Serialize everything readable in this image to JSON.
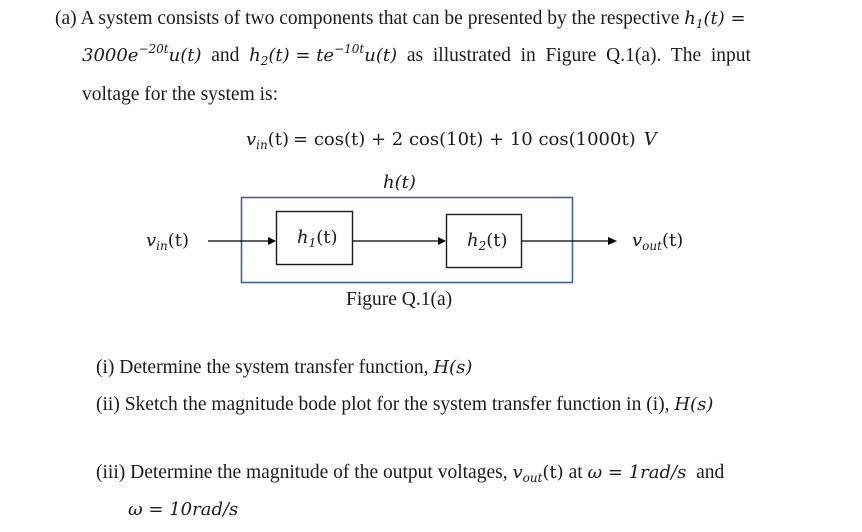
{
  "part_a": {
    "label": "(a)",
    "line1_text": "A system consists of two components that can be presented by the respective",
    "h1_lhs": "h",
    "h1_sub": "1",
    "h1_arg": "(t) =",
    "line2_h1_coef": "3000e",
    "line2_h1_exp": "−20t",
    "line2_h1_tail": "u(t)",
    "line2_and": "and",
    "h2_lhs": "h",
    "h2_sub": "2",
    "h2_arg": "(t) = te",
    "h2_exp": "−10t",
    "h2_tail": "u(t)",
    "line2_rest": "as  illustrated  in  Figure  Q.1(a).  The  input",
    "line3": "voltage for the system is:"
  },
  "equation": {
    "lhs_v": "v",
    "lhs_sub": "in",
    "lhs_arg": "(t)",
    "rhs": "= cos(t) + 2 cos(10t) + 10 cos(1000t)",
    "unit": "V"
  },
  "diagram": {
    "system_label": "h(t)",
    "input_label_v": "v",
    "input_label_sub": "in",
    "input_label_arg": "(t)",
    "block1_h": "h",
    "block1_sub": "1",
    "block1_arg": "(t)",
    "block2_h": "h",
    "block2_sub": "2",
    "block2_arg": "(t)",
    "output_label_v": "v",
    "output_label_sub": "out",
    "output_label_arg": "(t)",
    "caption": "Figure Q.1(a)",
    "colors": {
      "outer_box": "#41629a",
      "inner_box": "#1a1a1a",
      "arrow": "#000000"
    }
  },
  "questions": [
    {
      "label": "(i)",
      "text": "Determine the system transfer function,",
      "math": "H(s)"
    },
    {
      "label": "(ii)",
      "text": "Sketch the magnitude bode plot for the system transfer function in (i),",
      "math": "H(s)"
    },
    {
      "label": "(iii)",
      "text": "Determine the magnitude of the output voltages,",
      "v": "v",
      "v_sub": "out",
      "v_arg": "(t)",
      "at": "at",
      "w1": "ω = 1rad/s",
      "and": "and",
      "w2": "ω = 10rad/s"
    }
  ]
}
